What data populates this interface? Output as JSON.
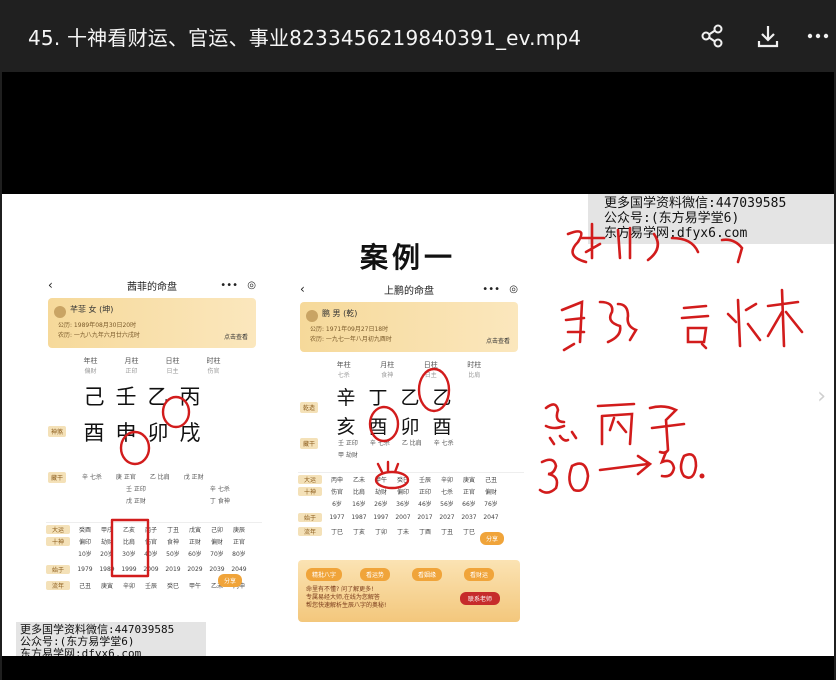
{
  "header": {
    "title": "45. 十神看财运、官运、事业8233456219840391_ev.mp4",
    "actions": [
      "share-icon",
      "download-icon",
      "more-icon"
    ]
  },
  "watermark": {
    "line1": "更多国学资料微信:447039585",
    "line2": "公众号:(东方易学堂6)",
    "line3": "东方易学网:dfyx6.com"
  },
  "slide": {
    "case_title": "案例一",
    "phone_a": {
      "header_title": "茜菲的命盘",
      "profile_name": "芊菲 女 (坤)",
      "profile_line1": "公历: 1989年08月30日20时",
      "profile_line2": "农历: 一九八九年六月廿六戌时",
      "profile_button": "点击查看",
      "columns": [
        {
          "name": "年柱",
          "sub": "偏财"
        },
        {
          "name": "月柱",
          "sub": "正印"
        },
        {
          "name": "日柱",
          "sub": "日主"
        },
        {
          "name": "时柱",
          "sub": "伤官"
        }
      ],
      "stems": [
        "己",
        "壬",
        "乙",
        "丙"
      ],
      "branches": [
        "酉",
        "申",
        "卯",
        "戌"
      ],
      "label_shensha": "神煞",
      "label_canggan": "藏干",
      "canggan": [
        "辛 七杀",
        "庚 正官",
        "乙 比肩",
        "戊 正财"
      ],
      "canggan2": [
        "",
        "壬 正印",
        "",
        "辛 七杀"
      ],
      "canggan3": [
        "",
        "戊 正财",
        "",
        "丁 食神"
      ],
      "dayun_label": "大运",
      "dayun": [
        "癸酉",
        "甲戌",
        "乙亥",
        "丙子",
        "丁丑",
        "戊寅",
        "己卯",
        "庚辰",
        "辛巳"
      ],
      "shishen_label": "十神",
      "shishen": [
        "偏印",
        "劫财",
        "比肩",
        "伤官",
        "食神",
        "正财",
        "偏财",
        "正官",
        "七杀"
      ],
      "ages": [
        "10岁",
        "20岁",
        "30岁",
        "40岁",
        "50岁",
        "60岁",
        "70岁",
        "80岁",
        "90岁"
      ],
      "years_label": "始于",
      "years": [
        "1979",
        "1989",
        "1999",
        "2009",
        "2019",
        "2029",
        "2039",
        "2049",
        "2059"
      ],
      "liunian_label": "流年",
      "liunian": [
        "己丑",
        "庚寅",
        "辛卯",
        "壬辰",
        "癸巳",
        "甲午",
        "乙未",
        "丙申",
        "丁酉"
      ],
      "share": "分享"
    },
    "phone_b": {
      "header_title": "上鹏的命盘",
      "profile_name": "鹏 男 (乾)",
      "profile_line1": "公历: 1971年09月27日18时",
      "profile_line2": "农历: 一九七一年八月初九酉时",
      "profile_button": "点击查看",
      "columns": [
        {
          "name": "年柱",
          "sub": "七杀"
        },
        {
          "name": "月柱",
          "sub": "食神"
        },
        {
          "name": "日柱",
          "sub": "日主"
        },
        {
          "name": "时柱",
          "sub": "比肩"
        }
      ],
      "label_qianzao": "乾造",
      "stems": [
        "辛",
        "丁",
        "乙",
        "乙"
      ],
      "branches": [
        "亥",
        "酉",
        "卯",
        "酉"
      ],
      "label_canggan": "藏干",
      "canggan": [
        "壬 正印",
        "辛 七杀",
        "乙 比肩",
        "辛 七杀"
      ],
      "canggan2": [
        "甲 劫财",
        "",
        "",
        ""
      ],
      "dayun_label": "大运",
      "dayun": [
        "丙申",
        "乙未",
        "甲午",
        "癸巳",
        "壬辰",
        "辛卯",
        "庚寅",
        "己丑",
        "戊子"
      ],
      "shishen_label": "十神",
      "shishen": [
        "伤官",
        "比肩",
        "劫财",
        "偏印",
        "正印",
        "七杀",
        "正官",
        "偏财",
        "正财"
      ],
      "ages": [
        "6岁",
        "16岁",
        "26岁",
        "36岁",
        "46岁",
        "56岁",
        "66岁",
        "76岁",
        "86岁"
      ],
      "years_label": "始于",
      "years": [
        "1977",
        "1987",
        "1997",
        "2007",
        "2017",
        "2027",
        "2037",
        "2047",
        "2057"
      ],
      "liunian_label": "流年",
      "liunian": [
        "丁巳",
        "丁亥",
        "丁卯",
        "丁未",
        "丁酉",
        "丁丑",
        "丁巳"
      ],
      "buttons": [
        "精批八字",
        "看运势",
        "看姻缘",
        "看财运"
      ],
      "promo1": "命里有不懂? 问了解更多!",
      "promo2": "专属易经大师,在线为您解答",
      "promo3": "帮您快速解析生辰八字的奥秘!",
      "contact": "联系老师",
      "share": "分享"
    },
    "handwriting": {
      "line1": "乙木 比肩",
      "line2": "身弱 喜 水木",
      "line3": "忌 丙子",
      "line4": "30 → 50."
    }
  }
}
